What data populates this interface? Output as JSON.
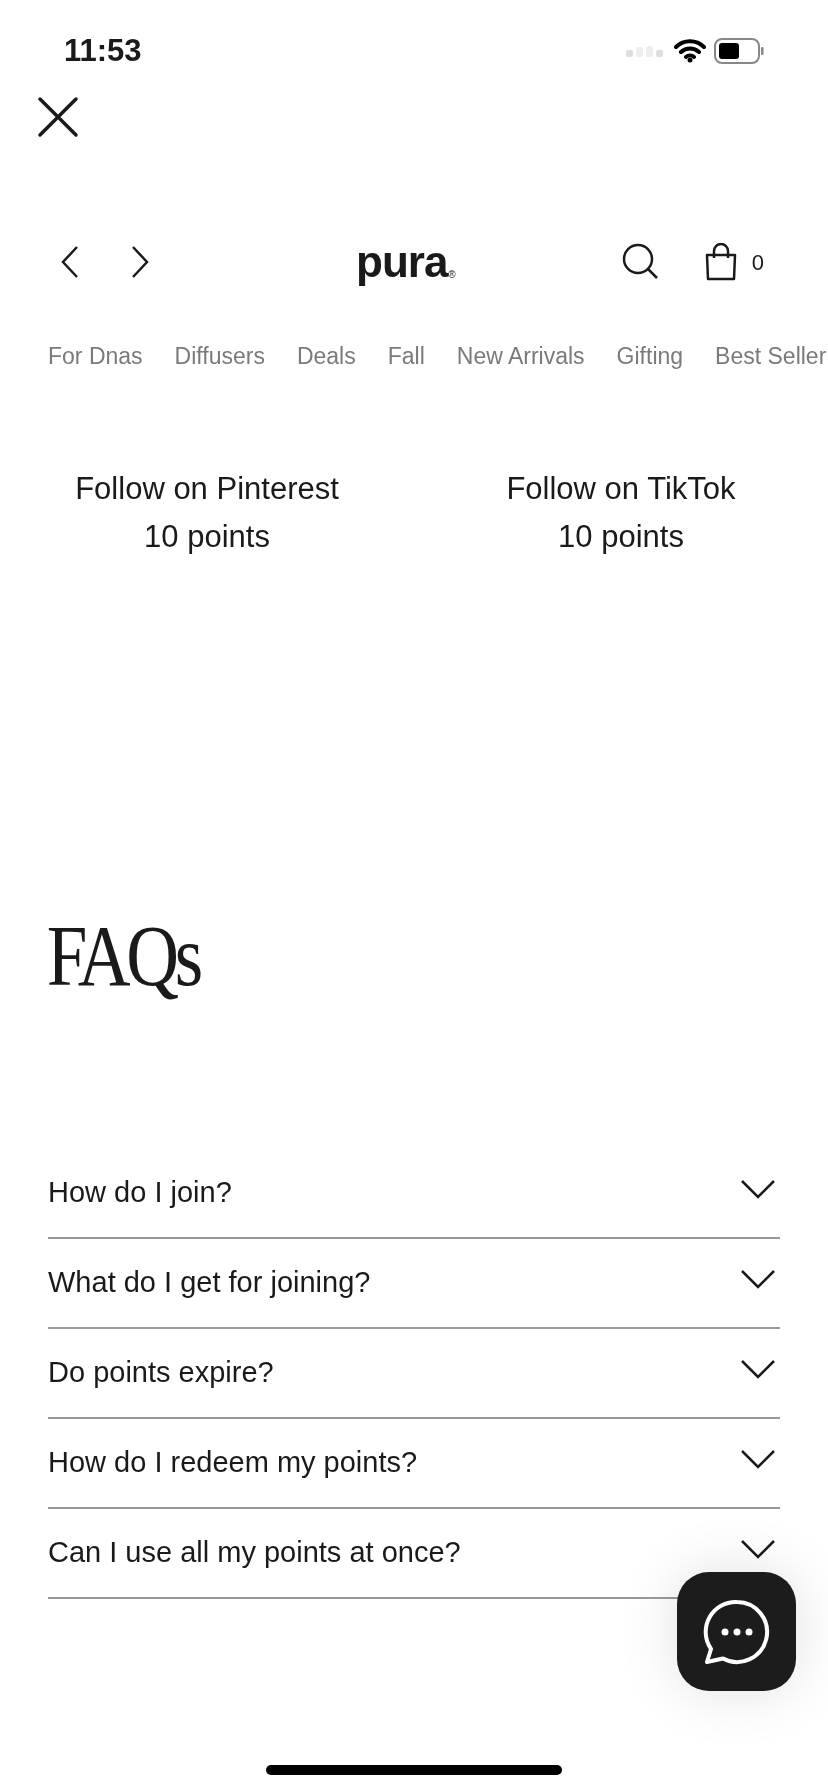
{
  "status_bar": {
    "time": "11:53"
  },
  "header": {
    "logo": "pura",
    "logo_mark": "®",
    "cart_count": "0"
  },
  "menu": [
    "For Dnas",
    "Diffusers",
    "Deals",
    "Fall",
    "New Arrivals",
    "Gifting",
    "Best Seller"
  ],
  "follow_actions": [
    {
      "label": "Follow on Pinterest",
      "points": "10 points"
    },
    {
      "label": "Follow on TikTok",
      "points": "10 points"
    }
  ],
  "faq": {
    "title": "FAQs",
    "items": [
      {
        "question": "How do I join?",
        "expanded": false
      },
      {
        "question": "What do I get for joining?",
        "expanded": false
      },
      {
        "question": "Do points expire?",
        "expanded": false
      },
      {
        "question": "How do I redeem my points?",
        "expanded": false
      },
      {
        "question": "Can I use all my points at once?",
        "expanded": false
      }
    ]
  }
}
